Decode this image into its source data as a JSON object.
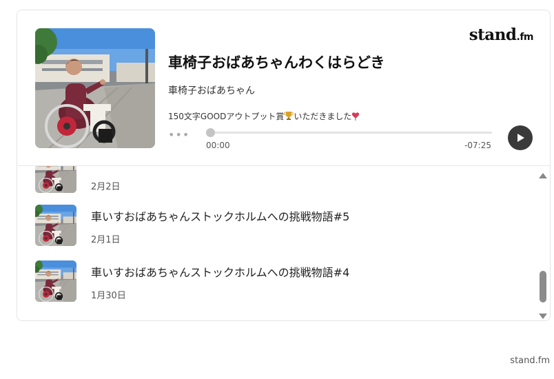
{
  "brand": {
    "name": "stand",
    "suffix": ".fm"
  },
  "player": {
    "title": "車椅子おばあちゃんわくはらどき",
    "channel": "車椅子おばあちゃん",
    "description_prefix": "150文字GOODアウトプット賞",
    "description_suffix": "いただきました",
    "more_label": "•••",
    "current_time": "00:00",
    "remaining_time": "-07:25",
    "progress": 0
  },
  "episodes": [
    {
      "title": "",
      "date": "2月2日"
    },
    {
      "title": "車いすおばあちゃんストックホルムへの挑戦物語#5",
      "date": "2月1日"
    },
    {
      "title": "車いすおばあちゃんストックホルムへの挑戦物語#4",
      "date": "1月30日"
    }
  ],
  "footer": {
    "text": "stand.fm"
  },
  "icons": {
    "play": "play-icon",
    "trophy": "trophy-icon",
    "heart": "heart-icon",
    "scroll_up": "scroll-up-icon",
    "scroll_down": "scroll-down-icon"
  },
  "colors": {
    "play_button": "#3a3a3a",
    "heart": "#d63a5a",
    "trophy": "#d9a32b"
  }
}
